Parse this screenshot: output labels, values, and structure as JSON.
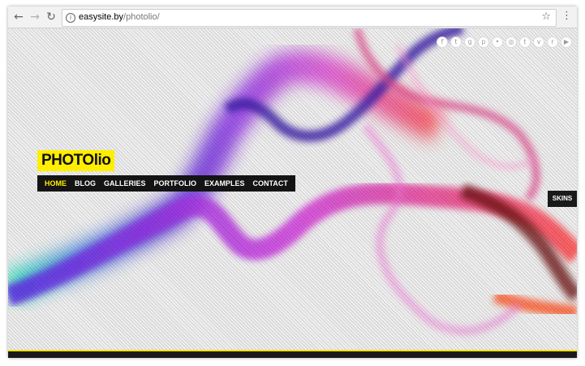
{
  "browser": {
    "url_host": "easysite.by",
    "url_path": "/photolio/"
  },
  "site": {
    "logo": "PHOTOlio",
    "menu": [
      {
        "label": "HOME",
        "active": true
      },
      {
        "label": "BLOG",
        "active": false
      },
      {
        "label": "GALLERIES",
        "active": false
      },
      {
        "label": "PORTFOLIO",
        "active": false
      },
      {
        "label": "EXAMPLES",
        "active": false
      },
      {
        "label": "CONTACT",
        "active": false
      }
    ],
    "skins_label": "SKINS",
    "social_icons": [
      "facebook-icon",
      "twitter-icon",
      "google-plus-icon",
      "pinterest-icon",
      "flickr-icon",
      "instagram-icon",
      "tumblr-icon",
      "vimeo-icon",
      "rss-icon",
      "youtube-icon"
    ]
  },
  "colors": {
    "logo_bg": "#ffee00",
    "menu_bg": "#141414",
    "menu_active": "#ffee00"
  }
}
